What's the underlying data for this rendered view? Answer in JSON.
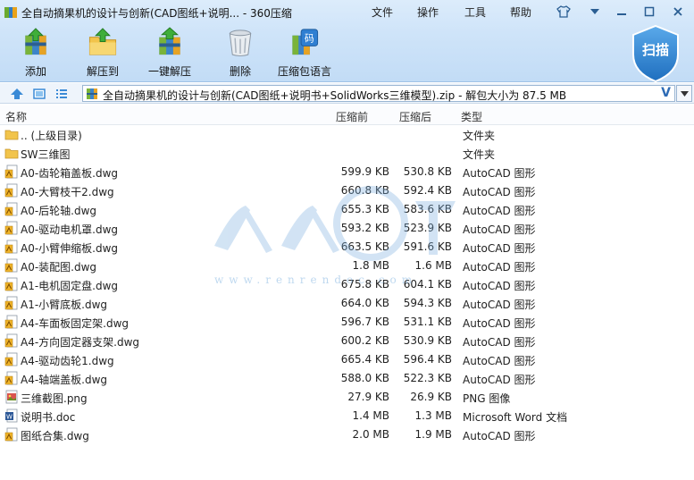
{
  "window": {
    "title": "全自动摘果机的设计与创新(CAD图纸+说明... - 360压缩",
    "menus": [
      "文件",
      "操作",
      "工具",
      "帮助"
    ]
  },
  "toolbar": {
    "add": "添加",
    "extract_to": "解压到",
    "one_click_extract": "一键解压",
    "delete": "删除",
    "language": "压缩包语言",
    "scan": "扫描"
  },
  "address": {
    "path": "全自动摘果机的设计与创新(CAD图纸+说明书+SolidWorks三维模型).zip - 解包大小为 87.5 MB",
    "v_mark": "V"
  },
  "columns": {
    "name": "名称",
    "packed": "压缩前",
    "original": "压缩后",
    "type": "类型"
  },
  "files": [
    {
      "icon": "folder-up-icon",
      "name": ".. (上级目录)",
      "packed": "",
      "original": "",
      "type": "文件夹"
    },
    {
      "icon": "folder-icon",
      "name": "SW三维图",
      "packed": "",
      "original": "",
      "type": "文件夹"
    },
    {
      "icon": "dwg-file-icon",
      "name": "A0-齿轮箱盖板.dwg",
      "packed": "599.9 KB",
      "original": "530.8 KB",
      "type": "AutoCAD 图形"
    },
    {
      "icon": "dwg-file-icon",
      "name": "A0-大臂枝干2.dwg",
      "packed": "660.8 KB",
      "original": "592.4 KB",
      "type": "AutoCAD 图形"
    },
    {
      "icon": "dwg-file-icon",
      "name": "A0-后轮轴.dwg",
      "packed": "655.3 KB",
      "original": "583.6 KB",
      "type": "AutoCAD 图形"
    },
    {
      "icon": "dwg-file-icon",
      "name": "A0-驱动电机罩.dwg",
      "packed": "593.2 KB",
      "original": "523.9 KB",
      "type": "AutoCAD 图形"
    },
    {
      "icon": "dwg-file-icon",
      "name": "A0-小臂伸缩板.dwg",
      "packed": "663.5 KB",
      "original": "591.6 KB",
      "type": "AutoCAD 图形"
    },
    {
      "icon": "dwg-file-icon",
      "name": "A0-装配图.dwg",
      "packed": "1.8 MB",
      "original": "1.6 MB",
      "type": "AutoCAD 图形"
    },
    {
      "icon": "dwg-file-icon",
      "name": "A1-电机固定盘.dwg",
      "packed": "675.8 KB",
      "original": "604.1 KB",
      "type": "AutoCAD 图形"
    },
    {
      "icon": "dwg-file-icon",
      "name": "A1-小臂底板.dwg",
      "packed": "664.0 KB",
      "original": "594.3 KB",
      "type": "AutoCAD 图形"
    },
    {
      "icon": "dwg-file-icon",
      "name": "A4-车面板固定架.dwg",
      "packed": "596.7 KB",
      "original": "531.1 KB",
      "type": "AutoCAD 图形"
    },
    {
      "icon": "dwg-file-icon",
      "name": "A4-方向固定器支架.dwg",
      "packed": "600.2 KB",
      "original": "530.9 KB",
      "type": "AutoCAD 图形"
    },
    {
      "icon": "dwg-file-icon",
      "name": "A4-驱动齿轮1.dwg",
      "packed": "665.4 KB",
      "original": "596.4 KB",
      "type": "AutoCAD 图形"
    },
    {
      "icon": "dwg-file-icon",
      "name": "A4-轴端盖板.dwg",
      "packed": "588.0 KB",
      "original": "522.3 KB",
      "type": "AutoCAD 图形"
    },
    {
      "icon": "png-file-icon",
      "name": "三维截图.png",
      "packed": "27.9 KB",
      "original": "26.9 KB",
      "type": "PNG 图像"
    },
    {
      "icon": "doc-file-icon",
      "name": "说明书.doc",
      "packed": "1.4 MB",
      "original": "1.3 MB",
      "type": "Microsoft Word 文档"
    },
    {
      "icon": "dwg-file-icon",
      "name": "图纸合集.dwg",
      "packed": "2.0 MB",
      "original": "1.9 MB",
      "type": "AutoCAD 图形"
    }
  ],
  "watermark": {
    "text": "www.renrendoc.com"
  },
  "colors": {
    "accent": "#2d6bb5",
    "band": "#cfe4f9",
    "scan_badge": "#3b8fd8"
  }
}
